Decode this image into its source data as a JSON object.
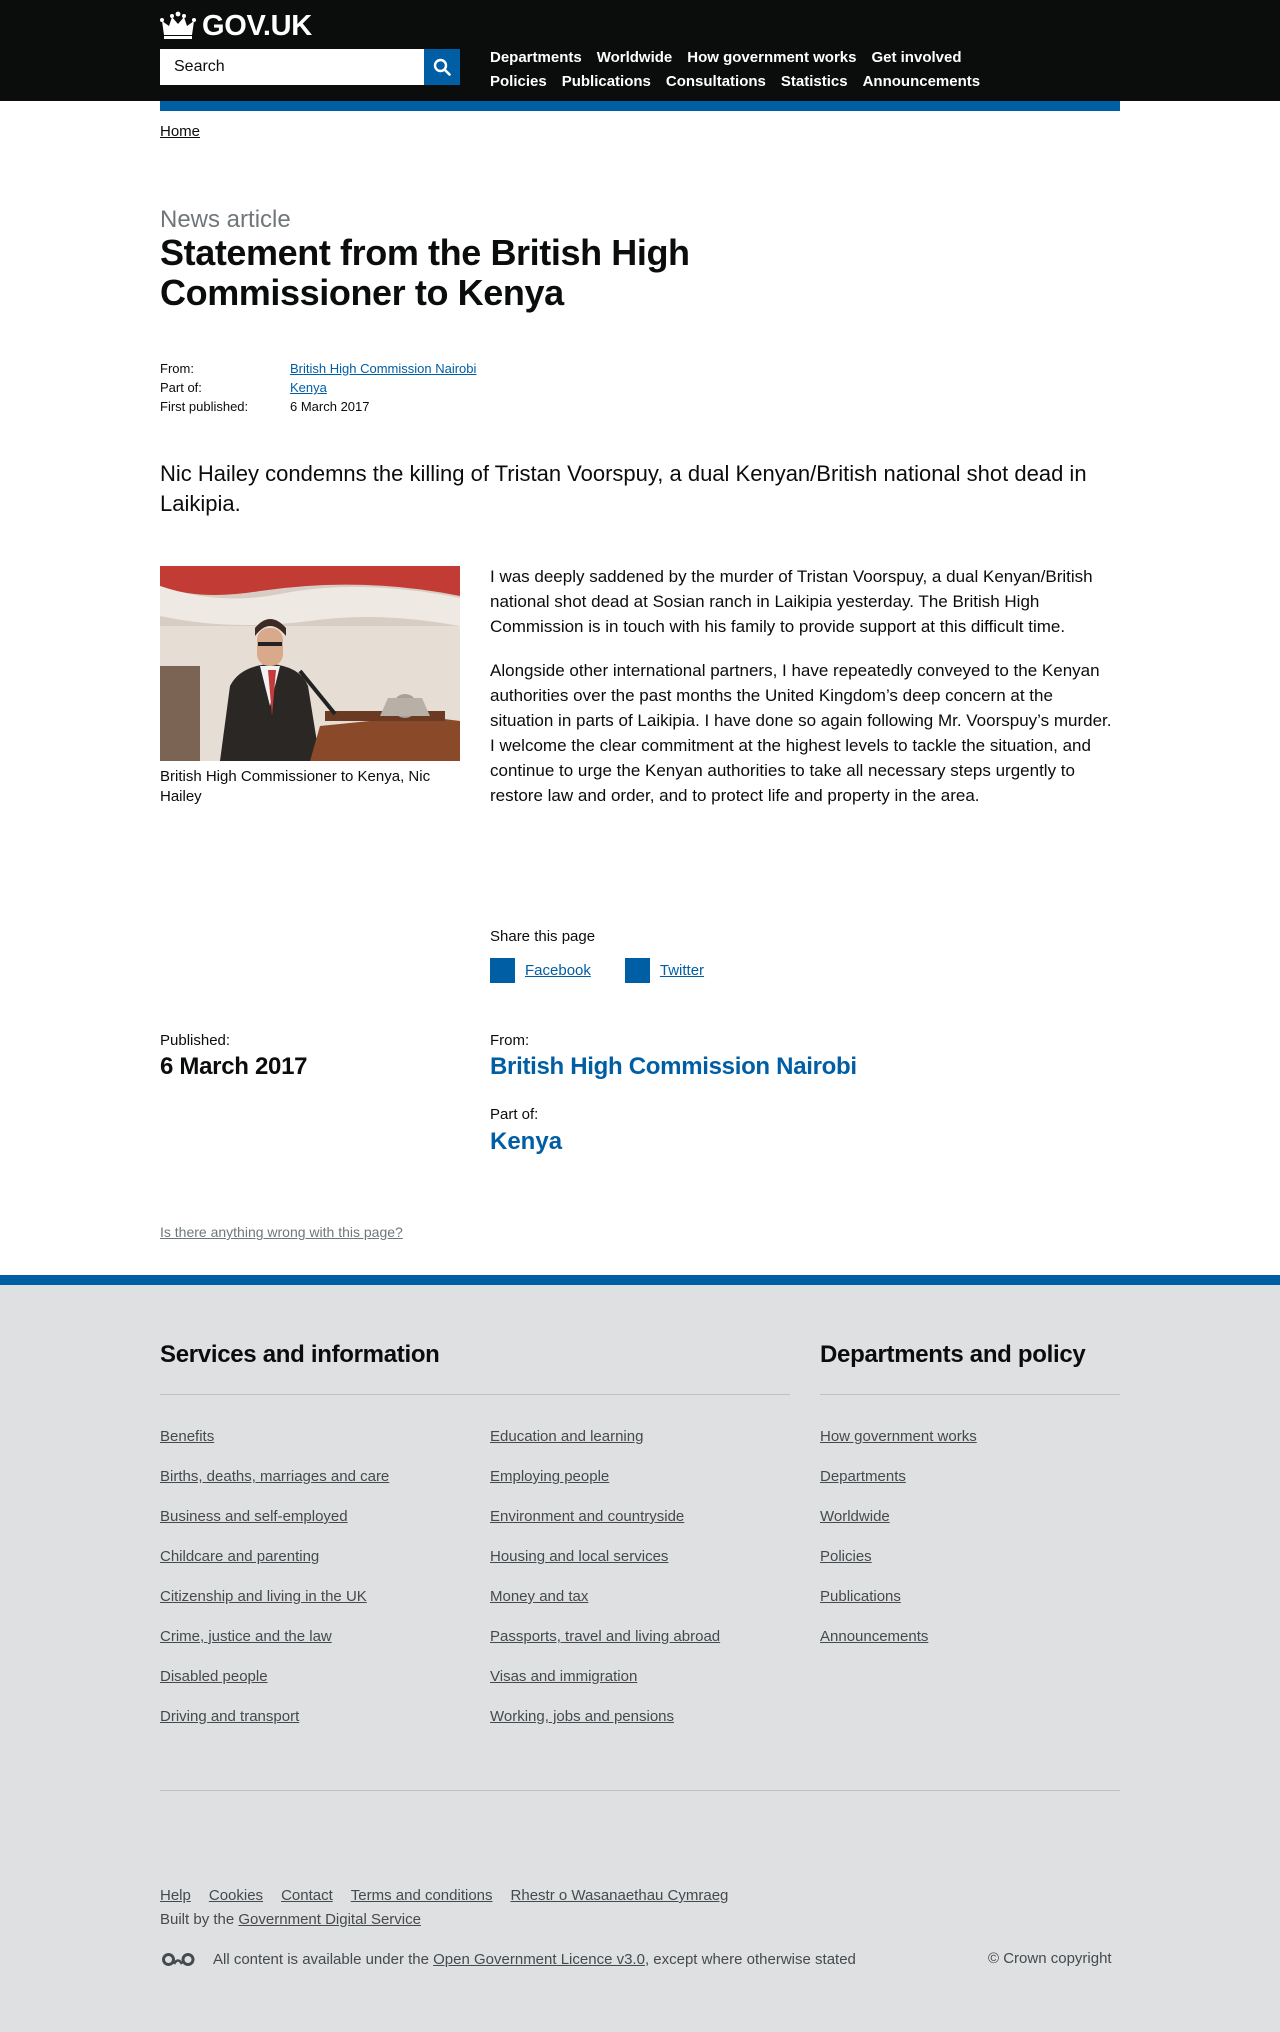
{
  "header": {
    "logo_text": "GOV.UK",
    "search_placeholder": "Search",
    "nav_row1": [
      "Departments",
      "Worldwide",
      "How government works",
      "Get involved"
    ],
    "nav_row2": [
      "Policies",
      "Publications",
      "Consultations",
      "Statistics",
      "Announcements"
    ]
  },
  "breadcrumb": {
    "home": "Home"
  },
  "article": {
    "doc_type": "News article",
    "title": "Statement from the British High Commissioner to Kenya",
    "meta": {
      "from_label": "From:",
      "from_value": "British High Commission Nairobi",
      "partof_label": "Part of:",
      "partof_value": "Kenya",
      "published_label": "First published:",
      "published_value": "6 March 2017"
    },
    "lead": "Nic Hailey condemns the killing of Tristan Voorspuy, a dual Kenyan/British national shot dead in Laikipia.",
    "image_caption": "British High Commissioner to Kenya, Nic Hailey",
    "body": [
      "I was deeply saddened by the murder of Tristan Voorspuy, a dual Kenyan/British national shot dead at Sosian ranch in Laikipia yesterday. The British High Commission is in touch with his family to provide support at this difficult time.",
      "Alongside other international partners, I have repeatedly conveyed to the Kenyan authorities over the past months the United Kingdom’s deep concern at the situation in parts of Laikipia. I have done so again following Mr. Voorspuy’s murder. I welcome the clear commitment at the highest levels to tackle the situation, and continue to urge the Kenyan authorities to take all necessary steps urgently to restore law and order, and to protect life and property in the area."
    ],
    "share": {
      "title": "Share this page",
      "facebook": "Facebook",
      "twitter": "Twitter"
    },
    "published_label": "Published:",
    "published_date": "6 March 2017",
    "from_label": "From:",
    "from_value": "British High Commission Nairobi",
    "partof_label": "Part of:",
    "partof_value": "Kenya",
    "report_link": "Is there anything wrong with this page?"
  },
  "footer": {
    "services_heading": "Services and information",
    "departments_heading": "Departments and policy",
    "col1": [
      "Benefits",
      "Births, deaths, marriages and care",
      "Business and self-employed",
      "Childcare and parenting",
      "Citizenship and living in the UK",
      "Crime, justice and the law",
      "Disabled people",
      "Driving and transport"
    ],
    "col2": [
      "Education and learning",
      "Employing people",
      "Environment and countryside",
      "Housing and local services",
      "Money and tax",
      "Passports, travel and living abroad",
      "Visas and immigration",
      "Working, jobs and pensions"
    ],
    "col3": [
      "How government works",
      "Departments",
      "Worldwide",
      "Policies",
      "Publications",
      "Announcements"
    ],
    "meta_links": [
      "Help",
      "Cookies",
      "Contact",
      "Terms and conditions",
      "Rhestr o Wasanaethau Cymraeg"
    ],
    "built_prefix": "Built by the ",
    "built_link": "Government Digital Service",
    "licence_prefix": "All content is available under the ",
    "licence_link": "Open Government Licence v3.0",
    "licence_suffix": ", except where otherwise stated",
    "copyright": "© Crown copyright"
  }
}
